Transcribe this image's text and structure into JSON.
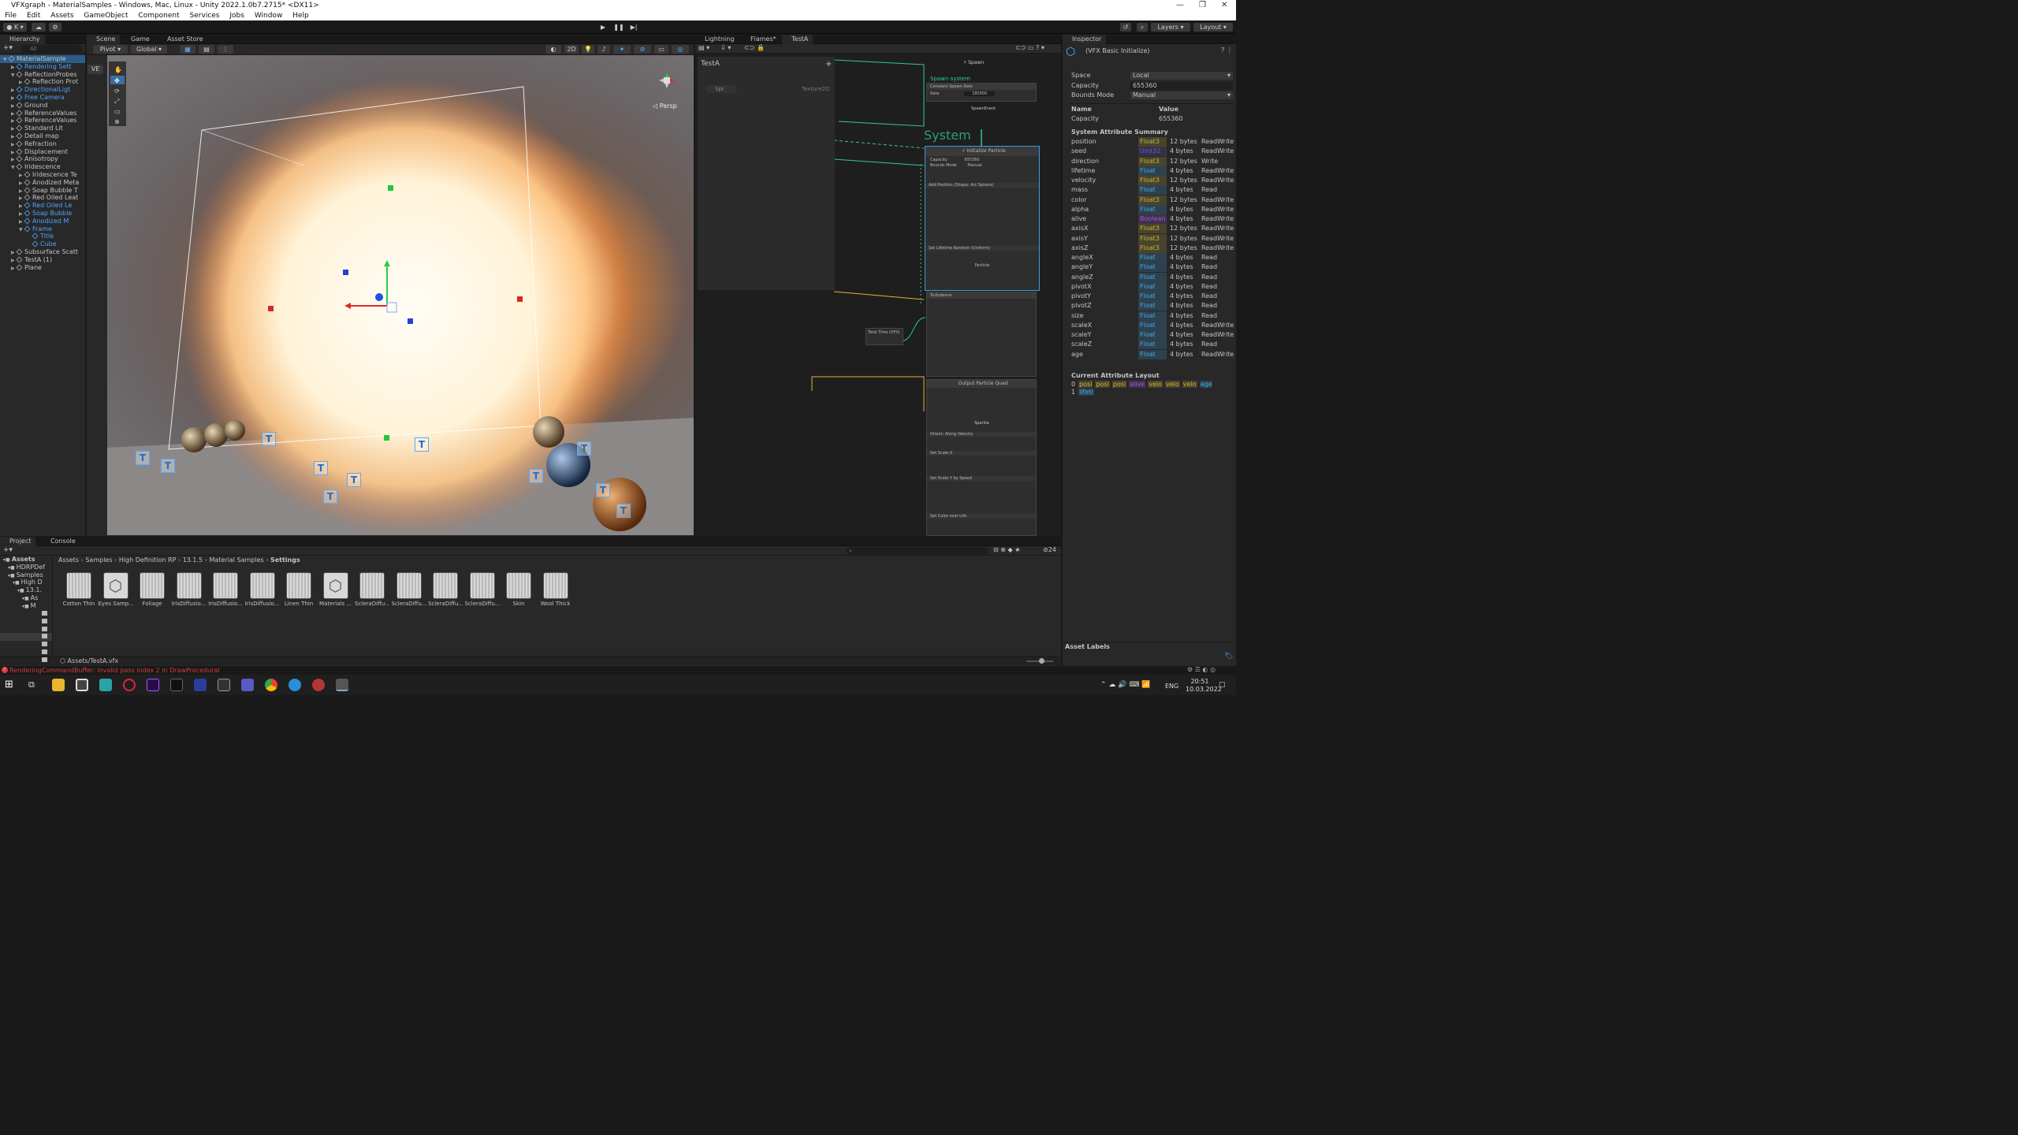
{
  "window": {
    "title": "VFXgraph - MaterialSamples - Windows, Mac, Linux - Unity 2022.1.0b7.2715* <DX11>"
  },
  "menu": [
    "File",
    "Edit",
    "Assets",
    "GameObject",
    "Component",
    "Services",
    "Jobs",
    "Window",
    "Help"
  ],
  "toolbar": {
    "account": "K",
    "layers": "Layers",
    "layout": "Layout"
  },
  "hierarchy": {
    "tab": "Hierarchy",
    "search_placeholder": "All",
    "items": [
      {
        "label": "MaterialSample",
        "depth": 0,
        "selected": true,
        "blue": false,
        "expanded": true
      },
      {
        "label": "Rendering Sett",
        "depth": 1,
        "blue": true
      },
      {
        "label": "ReflectionProbes",
        "depth": 1,
        "expanded": true
      },
      {
        "label": "Reflection Prot",
        "depth": 2
      },
      {
        "label": "DirectionalLigt",
        "depth": 1,
        "blue": true
      },
      {
        "label": "Free Camera",
        "depth": 1,
        "blue": true
      },
      {
        "label": "Ground",
        "depth": 1
      },
      {
        "label": "ReferenceValues",
        "depth": 1
      },
      {
        "label": "ReferenceValues",
        "depth": 1
      },
      {
        "label": "Standard Lit",
        "depth": 1
      },
      {
        "label": "Detail map",
        "depth": 1
      },
      {
        "label": "Refraction",
        "depth": 1
      },
      {
        "label": "Displacement",
        "depth": 1
      },
      {
        "label": "Anisotropy",
        "depth": 1
      },
      {
        "label": "Iridescence",
        "depth": 1,
        "expanded": true
      },
      {
        "label": "Iridescence Te",
        "depth": 2
      },
      {
        "label": "Anodized Meta",
        "depth": 2
      },
      {
        "label": "Soap Bubble T",
        "depth": 2
      },
      {
        "label": "Red Oiled Leat",
        "depth": 2
      },
      {
        "label": "Red Oiled Le",
        "depth": 2,
        "blue": true
      },
      {
        "label": "Soap Bubble",
        "depth": 2,
        "blue": true
      },
      {
        "label": "Anodized M",
        "depth": 2,
        "blue": true
      },
      {
        "label": "Frame",
        "depth": 2,
        "blue": true,
        "expanded": true
      },
      {
        "label": "Title",
        "depth": 3,
        "blue": true
      },
      {
        "label": "Cube",
        "depth": 3,
        "blue": true
      },
      {
        "label": "Subsurface Scatt",
        "depth": 1
      },
      {
        "label": "TestA (1)",
        "depth": 1
      },
      {
        "label": "Plane",
        "depth": 1
      }
    ]
  },
  "scene": {
    "tabs": [
      "Scene",
      "Game",
      "Asset Store"
    ],
    "pivot": "Pivot",
    "global": "Global",
    "mode2d": "2D",
    "persp": "Persp",
    "ve": "VE"
  },
  "vfx": {
    "tabs": [
      "Lightning",
      "Flames*",
      "TestA"
    ],
    "blackboard": {
      "title": "TestA",
      "item": "Spr",
      "item_type": "Texture2D"
    },
    "spawn_title": "Spawn",
    "spawn_system": "Spawn system",
    "constant_rate": "Constant Spawn Rate",
    "rate_label": "Rate",
    "rate_value": "180000",
    "spawn_event": "SpawnEvent",
    "system_label": "System",
    "init": {
      "title": "Initialize Particle",
      "capacity_label": "Capacity",
      "capacity_value": "655360",
      "bounds_label": "Bounds Mode",
      "bounds_value": "Manual",
      "add_position": "Add Position (Shape: Arc Sphere)",
      "set_lifetime": "Set Lifetime Random (Uniform)",
      "particle": "Particle"
    },
    "turbulence": "Turbulence",
    "total_time": "Total Time (VFX)",
    "output": {
      "title": "Output Particle Quad",
      "main_texture": "Sparkle",
      "orient": "Orient: Along Velocity",
      "set_scale": "Set Scale.X",
      "set_scale_y": "Set Scale.Y by Speed",
      "set_color": "Set Color over Life"
    }
  },
  "inspector": {
    "tab": "Inspector",
    "header": "(VFX Basic Initialize)",
    "space_label": "Space",
    "space_value": "Local",
    "capacity_label": "Capacity",
    "capacity_value": "655360",
    "bounds_label": "Bounds Mode",
    "bounds_value": "Manual",
    "col_name": "Name",
    "col_value": "Value",
    "cap_name": "Capacity",
    "cap_val": "655360",
    "summary_title": "System Attribute Summary",
    "attributes": [
      {
        "name": "position",
        "type": "Float3",
        "size": "12 bytes",
        "access": "ReadWrite",
        "color": "#c8b23a"
      },
      {
        "name": "seed",
        "type": "Uint32",
        "size": "4 bytes",
        "access": "ReadWrite",
        "color": "#6a56c8"
      },
      {
        "name": "direction",
        "type": "Float3",
        "size": "12 bytes",
        "access": "Write",
        "color": "#c8b23a"
      },
      {
        "name": "lifetime",
        "type": "Float",
        "size": "4 bytes",
        "access": "ReadWrite",
        "color": "#45a7e8"
      },
      {
        "name": "velocity",
        "type": "Float3",
        "size": "12 bytes",
        "access": "ReadWrite",
        "color": "#c8b23a"
      },
      {
        "name": "mass",
        "type": "Float",
        "size": "4 bytes",
        "access": "Read",
        "color": "#45a7e8"
      },
      {
        "name": "color",
        "type": "Float3",
        "size": "12 bytes",
        "access": "ReadWrite",
        "color": "#c8b23a"
      },
      {
        "name": "alpha",
        "type": "Float",
        "size": "4 bytes",
        "access": "ReadWrite",
        "color": "#45a7e8"
      },
      {
        "name": "alive",
        "type": "Boolean",
        "size": "4 bytes",
        "access": "ReadWrite",
        "color": "#9a58d8"
      },
      {
        "name": "axisX",
        "type": "Float3",
        "size": "12 bytes",
        "access": "ReadWrite",
        "color": "#c8b23a"
      },
      {
        "name": "axisY",
        "type": "Float3",
        "size": "12 bytes",
        "access": "ReadWrite",
        "color": "#c8b23a"
      },
      {
        "name": "axisZ",
        "type": "Float3",
        "size": "12 bytes",
        "access": "ReadWrite",
        "color": "#c8b23a"
      },
      {
        "name": "angleX",
        "type": "Float",
        "size": "4 bytes",
        "access": "Read",
        "color": "#45a7e8"
      },
      {
        "name": "angleY",
        "type": "Float",
        "size": "4 bytes",
        "access": "Read",
        "color": "#45a7e8"
      },
      {
        "name": "angleZ",
        "type": "Float",
        "size": "4 bytes",
        "access": "Read",
        "color": "#45a7e8"
      },
      {
        "name": "pivotX",
        "type": "Float",
        "size": "4 bytes",
        "access": "Read",
        "color": "#45a7e8"
      },
      {
        "name": "pivotY",
        "type": "Float",
        "size": "4 bytes",
        "access": "Read",
        "color": "#45a7e8"
      },
      {
        "name": "pivotZ",
        "type": "Float",
        "size": "4 bytes",
        "access": "Read",
        "color": "#45a7e8"
      },
      {
        "name": "size",
        "type": "Float",
        "size": "4 bytes",
        "access": "Read",
        "color": "#45a7e8"
      },
      {
        "name": "scaleX",
        "type": "Float",
        "size": "4 bytes",
        "access": "ReadWrite",
        "color": "#45a7e8"
      },
      {
        "name": "scaleY",
        "type": "Float",
        "size": "4 bytes",
        "access": "ReadWrite",
        "color": "#45a7e8"
      },
      {
        "name": "scaleZ",
        "type": "Float",
        "size": "4 bytes",
        "access": "Read",
        "color": "#45a7e8"
      },
      {
        "name": "age",
        "type": "Float",
        "size": "4 bytes",
        "access": "ReadWrite",
        "color": "#45a7e8"
      }
    ],
    "layout_title": "Current Attribute Layout",
    "layout_row0": {
      "index": "0",
      "items": [
        {
          "t": "posi",
          "c": "#c8b23a"
        },
        {
          "t": "posi",
          "c": "#c8b23a"
        },
        {
          "t": "posi",
          "c": "#c8b23a"
        },
        {
          "t": "alive",
          "c": "#9a58d8"
        },
        {
          "t": "velo",
          "c": "#c8b23a"
        },
        {
          "t": "velo",
          "c": "#c8b23a"
        },
        {
          "t": "velo",
          "c": "#c8b23a"
        },
        {
          "t": "age",
          "c": "#45a7e8"
        }
      ]
    },
    "layout_row1": {
      "index": "1",
      "items": [
        {
          "t": "lifeti",
          "c": "#45a7e8"
        }
      ]
    },
    "asset_labels": "Asset Labels"
  },
  "project": {
    "tabs": [
      "Project",
      "Console"
    ],
    "breadcrumb": [
      "Assets",
      "Samples",
      "High Definition RP",
      "13.1.5",
      "Material Samples",
      "Settings"
    ],
    "tree": [
      {
        "label": "Assets",
        "depth": 0
      },
      {
        "label": "HDRPDef",
        "depth": 1
      },
      {
        "label": "Samples",
        "depth": 1
      },
      {
        "label": "High D",
        "depth": 2
      },
      {
        "label": "13.1.",
        "depth": 3
      },
      {
        "label": "As",
        "depth": 4
      },
      {
        "label": "M",
        "depth": 4
      }
    ],
    "assets": [
      {
        "label": "Cotton Thin",
        "kind": "grid"
      },
      {
        "label": "Eyes Samp...",
        "kind": "box"
      },
      {
        "label": "Foliage",
        "kind": "grid"
      },
      {
        "label": "IrisDiffusio...",
        "kind": "grid"
      },
      {
        "label": "IrisDiffusio...",
        "kind": "grid"
      },
      {
        "label": "IrisDiffusio...",
        "kind": "grid"
      },
      {
        "label": "Linen Thin",
        "kind": "grid"
      },
      {
        "label": "Materials ...",
        "kind": "box"
      },
      {
        "label": "ScleraDiffu...",
        "kind": "grid"
      },
      {
        "label": "ScleraDiffu...",
        "kind": "grid"
      },
      {
        "label": "ScleraDiffu...",
        "kind": "grid"
      },
      {
        "label": "ScleraDiffu...",
        "kind": "grid"
      },
      {
        "label": "Skin",
        "kind": "grid"
      },
      {
        "label": "Wool Thick",
        "kind": "grid"
      }
    ],
    "selected_path": "Assets/TestA.vfx",
    "hidden_count": "24"
  },
  "status": {
    "error": "RenderingCommandBuffer: invalid pass index 2 in DrawProcedural"
  },
  "taskbar": {
    "lang": "ENG",
    "time": "20:51",
    "date": "10.03.2022"
  }
}
